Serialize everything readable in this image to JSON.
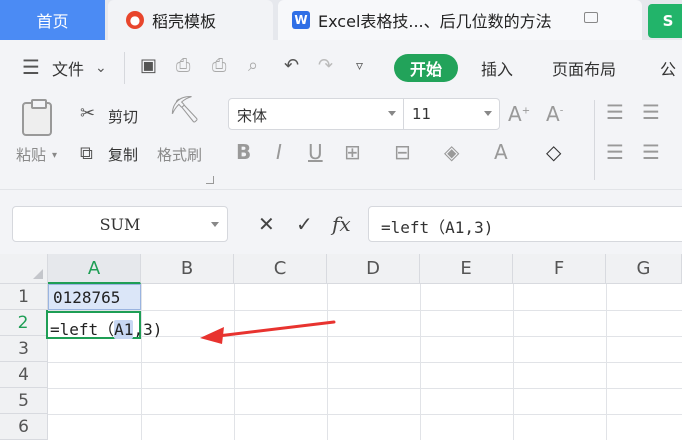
{
  "tabs": {
    "home": "首页",
    "docer": "稻壳模板",
    "doc": "Excel表格技...、后几位数的方法",
    "green_letter": "S"
  },
  "menu": {
    "file": "文件",
    "start": "开始",
    "insert": "插入",
    "page_layout": "页面布局",
    "formula_partial": "公"
  },
  "toolbar": {
    "paste": "粘贴",
    "cut": "剪切",
    "copy": "复制",
    "format_painter": "格式刷",
    "font_name": "宋体",
    "font_size": "11"
  },
  "formula_bar": {
    "name_box": "SUM",
    "fx_label": "fx",
    "formula": "=left（A1,3)"
  },
  "grid": {
    "columns": [
      "A",
      "B",
      "C",
      "D",
      "E",
      "F",
      "G"
    ],
    "rows": [
      "1",
      "2",
      "3",
      "4",
      "5",
      "6"
    ],
    "a1_value": "0128765",
    "a2_prefix": "=left（",
    "a2_ref": "A1",
    "a2_suffix": ",3)"
  },
  "colors": {
    "accent_green": "#22a35a",
    "tab_blue": "#4b8bf4",
    "annotation_red": "#e8332f"
  }
}
